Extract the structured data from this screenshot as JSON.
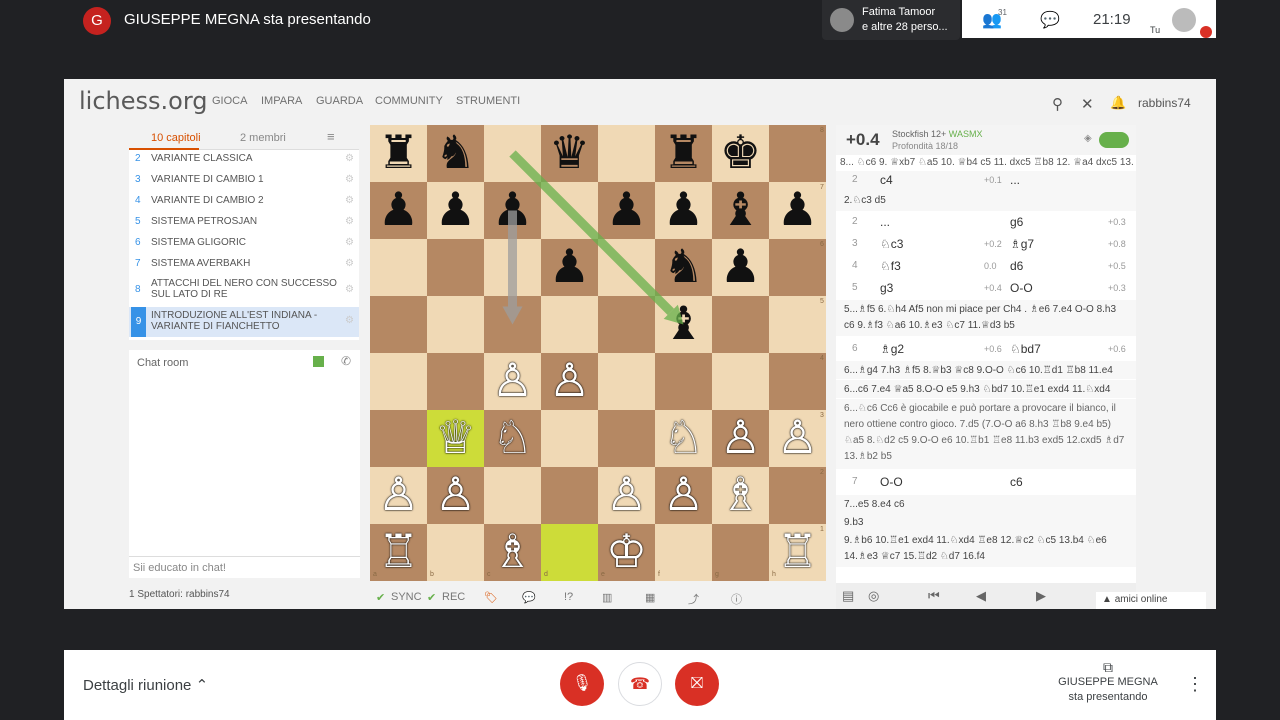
{
  "meet": {
    "presenter_initial": "G",
    "presenter_banner": "GIUSEPPE MEGNA sta presentando",
    "participant_name": "Fatima Tamoor",
    "participant_others": "e altre 28 perso...",
    "people_count": "31",
    "time": "21:19",
    "self_label": "Tu",
    "details_label": "Dettagli riunione",
    "presenting_line1": "GIUSEPPE MEGNA",
    "presenting_line2": "sta presentando"
  },
  "lichess": {
    "logo": "lichess.org",
    "nav": [
      "GIOCA",
      "IMPARA",
      "GUARDA",
      "COMMUNITY",
      "STRUMENTI"
    ],
    "username": "rabbins74",
    "tabs": {
      "chapters": "10 capitoli",
      "members": "2 membri"
    },
    "chapters": [
      {
        "n": "2",
        "label": "VARIANTE CLASSICA"
      },
      {
        "n": "3",
        "label": "VARIANTE DI CAMBIO 1"
      },
      {
        "n": "4",
        "label": "VARIANTE DI CAMBIO 2"
      },
      {
        "n": "5",
        "label": "SISTEMA PETROSJAN"
      },
      {
        "n": "6",
        "label": "SISTEMA GLIGORIC"
      },
      {
        "n": "7",
        "label": "SISTEMA AVERBAKH"
      },
      {
        "n": "8",
        "label": "ATTACCHI DEL NERO CON SUCCESSO SUL LATO DI RE"
      },
      {
        "n": "9",
        "label": "INTRODUZIONE ALL'EST INDIANA - VARIANTE DI FIANCHETTO"
      }
    ],
    "chat_title": "Chat room",
    "chat_placeholder": "Sii educato in chat!",
    "spectators": "1 Spettatori: rabbins74",
    "controls": {
      "sync": "SYNC",
      "rec": "REC"
    },
    "engine": {
      "eval": "+0.4",
      "name": "Stockfish 12+",
      "mode": "WASMX",
      "depth": "Profondità 18/18",
      "pv": "8... ♘c6 9. ♕xb7 ♘a5 10. ♕b4 c5 11. dxc5 ♖b8 12. ♕a4 dxc5 13. O..."
    },
    "moves": [
      {
        "idx": "2",
        "w": "c4",
        "we": "+0.1",
        "b": "...",
        "be": ""
      },
      {
        "idx": "2",
        "w": "...",
        "we": "",
        "b": "g6",
        "be": "+0.3"
      },
      {
        "idx": "3",
        "w": "♘c3",
        "we": "+0.2",
        "b": "♗g7",
        "be": "+0.8"
      },
      {
        "idx": "4",
        "w": "♘f3",
        "we": "0.0",
        "b": "d6",
        "be": "+0.5"
      },
      {
        "idx": "5",
        "w": "g3",
        "we": "+0.4",
        "b": "O-O",
        "be": "+0.3"
      },
      {
        "idx": "6",
        "w": "♗g2",
        "we": "+0.6",
        "b": "♘bd7",
        "be": "+0.6"
      },
      {
        "idx": "7",
        "w": "O-O",
        "we": "",
        "b": "c6",
        "be": ""
      }
    ],
    "comments": {
      "c1": "2.♘c3 d5",
      "c2": "5...♗f5 6.♘h4 Af5 non mi piace per Ch4 . ♗e6 7.e4 O-O 8.h3 c6 9.♗f3 ♘a6 10.♗e3 ♘c7 11.♕d3 b5",
      "c3": "6...♗g4 7.h3 ♗f5 8.♕b3 ♕c8 9.O-O ♘c6 10.♖d1 ♖b8 11.e4",
      "c4": "6...c6 7.e4 ♕a5 8.O-O e5 9.h3 ♘bd7 10.♖e1 exd4 11.♘xd4",
      "c5": "6...♘c6 Cc6 è giocabile e può portare a provocare il bianco, il nero ottiene contro gioco. 7.d5 (7.O-O a6 8.h3 ♖b8 9.e4 b5) ♘a5 8.♘d2 c5 9.O-O e6 10.♖b1 ♖e8 11.b3 exd5 12.cxd5 ♗d7 13.♗b2 b5",
      "c6": "7...e5 8.e4 c6",
      "c7": "9.b3",
      "c8": "9.♗b6 10.♖e1 exd4 11.♘xd4 ♖e8 12.♕c2 ♘c5 13.b4 ♘e6 14.♗e3 ♕c7 15.♖d2 ♘d7 16.f4"
    },
    "friends": "amici online"
  },
  "board": {
    "light": "#f0d9b5",
    "dark": "#b58863",
    "highlight": "#cddc39",
    "arrow_color": "#67b04b",
    "files": [
      "a",
      "b",
      "c",
      "d",
      "e",
      "f",
      "g",
      "h"
    ],
    "ranks": [
      "8",
      "7",
      "6",
      "5",
      "4",
      "3",
      "2",
      "1"
    ],
    "pieces": [
      {
        "sq": "a8",
        "p": "♜"
      },
      {
        "sq": "b8",
        "p": "♞"
      },
      {
        "sq": "d8",
        "p": "♛"
      },
      {
        "sq": "f8",
        "p": "♜"
      },
      {
        "sq": "g8",
        "p": "♚"
      },
      {
        "sq": "a7",
        "p": "♟"
      },
      {
        "sq": "b7",
        "p": "♟"
      },
      {
        "sq": "c7",
        "p": "♟"
      },
      {
        "sq": "e7",
        "p": "♟"
      },
      {
        "sq": "f7",
        "p": "♟"
      },
      {
        "sq": "g7",
        "p": "♝"
      },
      {
        "sq": "h7",
        "p": "♟"
      },
      {
        "sq": "d6",
        "p": "♟"
      },
      {
        "sq": "f6",
        "p": "♞"
      },
      {
        "sq": "g6",
        "p": "♟"
      },
      {
        "sq": "f5",
        "p": "♝"
      },
      {
        "sq": "c4",
        "p": "♙"
      },
      {
        "sq": "d4",
        "p": "♙"
      },
      {
        "sq": "b3",
        "p": "♕"
      },
      {
        "sq": "c3",
        "p": "♘"
      },
      {
        "sq": "f3",
        "p": "♘"
      },
      {
        "sq": "g3",
        "p": "♙"
      },
      {
        "sq": "h3",
        "p": "♙"
      },
      {
        "sq": "a2",
        "p": "♙"
      },
      {
        "sq": "b2",
        "p": "♙"
      },
      {
        "sq": "e2",
        "p": "♙"
      },
      {
        "sq": "f2",
        "p": "♙"
      },
      {
        "sq": "g2",
        "p": "♗"
      },
      {
        "sq": "a1",
        "p": "♖"
      },
      {
        "sq": "c1",
        "p": "♗"
      },
      {
        "sq": "e1",
        "p": "♔"
      },
      {
        "sq": "h1",
        "p": "♖"
      }
    ],
    "highlighted": [
      "b3",
      "d1"
    ],
    "arrows": [
      {
        "from": "c7",
        "to": "c5",
        "color": "#9e9e9e"
      },
      {
        "from": "c8",
        "to": "f5",
        "color": "#67b04b"
      }
    ]
  }
}
